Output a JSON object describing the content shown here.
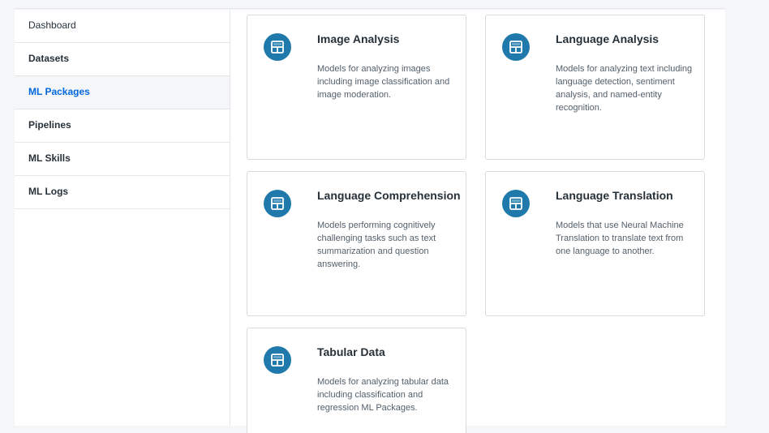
{
  "sidebar": {
    "items": [
      {
        "label": "Dashboard"
      },
      {
        "label": "Datasets"
      },
      {
        "label": "ML Packages"
      },
      {
        "label": "Pipelines"
      },
      {
        "label": "ML Skills"
      },
      {
        "label": "ML Logs"
      }
    ],
    "active_item": "ML Packages"
  },
  "cards": [
    {
      "title": "Image Analysis",
      "description": "Models for analyzing images including image classification and image moderation.",
      "icon": "package-icon"
    },
    {
      "title": "Language Analysis",
      "description": "Models for analyzing text including language detection, sentiment analysis, and named-entity recognition.",
      "icon": "package-icon"
    },
    {
      "title": "Language Comprehension",
      "description": "Models performing cognitively challenging tasks such as text summarization and question answering.",
      "icon": "package-icon"
    },
    {
      "title": "Language Translation",
      "description": "Models that use Neural Machine Translation to translate text from one language to another.",
      "icon": "package-icon"
    },
    {
      "title": "Tabular Data",
      "description": "Models for analyzing tabular data including classification and regression ML Packages.",
      "icon": "package-icon"
    }
  ],
  "colors": {
    "accent": "#0067df",
    "icon_bg": "#1f79aa",
    "border": "#d6dbe0"
  }
}
